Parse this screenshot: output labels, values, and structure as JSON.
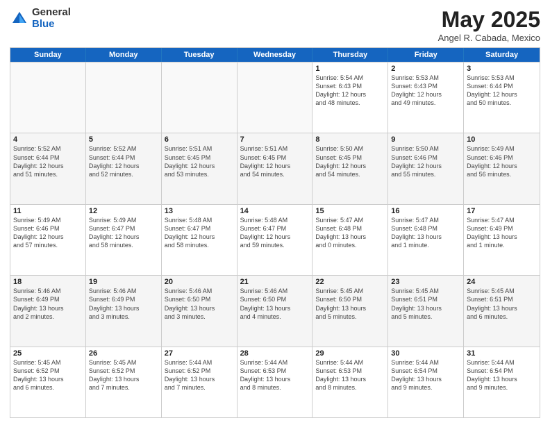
{
  "header": {
    "logo_general": "General",
    "logo_blue": "Blue",
    "title": "May 2025",
    "subtitle": "Angel R. Cabada, Mexico"
  },
  "weekdays": [
    "Sunday",
    "Monday",
    "Tuesday",
    "Wednesday",
    "Thursday",
    "Friday",
    "Saturday"
  ],
  "rows": [
    [
      {
        "day": "",
        "info": "",
        "empty": true
      },
      {
        "day": "",
        "info": "",
        "empty": true
      },
      {
        "day": "",
        "info": "",
        "empty": true
      },
      {
        "day": "",
        "info": "",
        "empty": true
      },
      {
        "day": "1",
        "info": "Sunrise: 5:54 AM\nSunset: 6:43 PM\nDaylight: 12 hours\nand 48 minutes."
      },
      {
        "day": "2",
        "info": "Sunrise: 5:53 AM\nSunset: 6:43 PM\nDaylight: 12 hours\nand 49 minutes."
      },
      {
        "day": "3",
        "info": "Sunrise: 5:53 AM\nSunset: 6:44 PM\nDaylight: 12 hours\nand 50 minutes."
      }
    ],
    [
      {
        "day": "4",
        "info": "Sunrise: 5:52 AM\nSunset: 6:44 PM\nDaylight: 12 hours\nand 51 minutes."
      },
      {
        "day": "5",
        "info": "Sunrise: 5:52 AM\nSunset: 6:44 PM\nDaylight: 12 hours\nand 52 minutes."
      },
      {
        "day": "6",
        "info": "Sunrise: 5:51 AM\nSunset: 6:45 PM\nDaylight: 12 hours\nand 53 minutes."
      },
      {
        "day": "7",
        "info": "Sunrise: 5:51 AM\nSunset: 6:45 PM\nDaylight: 12 hours\nand 54 minutes."
      },
      {
        "day": "8",
        "info": "Sunrise: 5:50 AM\nSunset: 6:45 PM\nDaylight: 12 hours\nand 54 minutes."
      },
      {
        "day": "9",
        "info": "Sunrise: 5:50 AM\nSunset: 6:46 PM\nDaylight: 12 hours\nand 55 minutes."
      },
      {
        "day": "10",
        "info": "Sunrise: 5:49 AM\nSunset: 6:46 PM\nDaylight: 12 hours\nand 56 minutes."
      }
    ],
    [
      {
        "day": "11",
        "info": "Sunrise: 5:49 AM\nSunset: 6:46 PM\nDaylight: 12 hours\nand 57 minutes."
      },
      {
        "day": "12",
        "info": "Sunrise: 5:49 AM\nSunset: 6:47 PM\nDaylight: 12 hours\nand 58 minutes."
      },
      {
        "day": "13",
        "info": "Sunrise: 5:48 AM\nSunset: 6:47 PM\nDaylight: 12 hours\nand 58 minutes."
      },
      {
        "day": "14",
        "info": "Sunrise: 5:48 AM\nSunset: 6:47 PM\nDaylight: 12 hours\nand 59 minutes."
      },
      {
        "day": "15",
        "info": "Sunrise: 5:47 AM\nSunset: 6:48 PM\nDaylight: 13 hours\nand 0 minutes."
      },
      {
        "day": "16",
        "info": "Sunrise: 5:47 AM\nSunset: 6:48 PM\nDaylight: 13 hours\nand 1 minute."
      },
      {
        "day": "17",
        "info": "Sunrise: 5:47 AM\nSunset: 6:49 PM\nDaylight: 13 hours\nand 1 minute."
      }
    ],
    [
      {
        "day": "18",
        "info": "Sunrise: 5:46 AM\nSunset: 6:49 PM\nDaylight: 13 hours\nand 2 minutes."
      },
      {
        "day": "19",
        "info": "Sunrise: 5:46 AM\nSunset: 6:49 PM\nDaylight: 13 hours\nand 3 minutes."
      },
      {
        "day": "20",
        "info": "Sunrise: 5:46 AM\nSunset: 6:50 PM\nDaylight: 13 hours\nand 3 minutes."
      },
      {
        "day": "21",
        "info": "Sunrise: 5:46 AM\nSunset: 6:50 PM\nDaylight: 13 hours\nand 4 minutes."
      },
      {
        "day": "22",
        "info": "Sunrise: 5:45 AM\nSunset: 6:50 PM\nDaylight: 13 hours\nand 5 minutes."
      },
      {
        "day": "23",
        "info": "Sunrise: 5:45 AM\nSunset: 6:51 PM\nDaylight: 13 hours\nand 5 minutes."
      },
      {
        "day": "24",
        "info": "Sunrise: 5:45 AM\nSunset: 6:51 PM\nDaylight: 13 hours\nand 6 minutes."
      }
    ],
    [
      {
        "day": "25",
        "info": "Sunrise: 5:45 AM\nSunset: 6:52 PM\nDaylight: 13 hours\nand 6 minutes."
      },
      {
        "day": "26",
        "info": "Sunrise: 5:45 AM\nSunset: 6:52 PM\nDaylight: 13 hours\nand 7 minutes."
      },
      {
        "day": "27",
        "info": "Sunrise: 5:44 AM\nSunset: 6:52 PM\nDaylight: 13 hours\nand 7 minutes."
      },
      {
        "day": "28",
        "info": "Sunrise: 5:44 AM\nSunset: 6:53 PM\nDaylight: 13 hours\nand 8 minutes."
      },
      {
        "day": "29",
        "info": "Sunrise: 5:44 AM\nSunset: 6:53 PM\nDaylight: 13 hours\nand 8 minutes."
      },
      {
        "day": "30",
        "info": "Sunrise: 5:44 AM\nSunset: 6:54 PM\nDaylight: 13 hours\nand 9 minutes."
      },
      {
        "day": "31",
        "info": "Sunrise: 5:44 AM\nSunset: 6:54 PM\nDaylight: 13 hours\nand 9 minutes."
      }
    ]
  ]
}
